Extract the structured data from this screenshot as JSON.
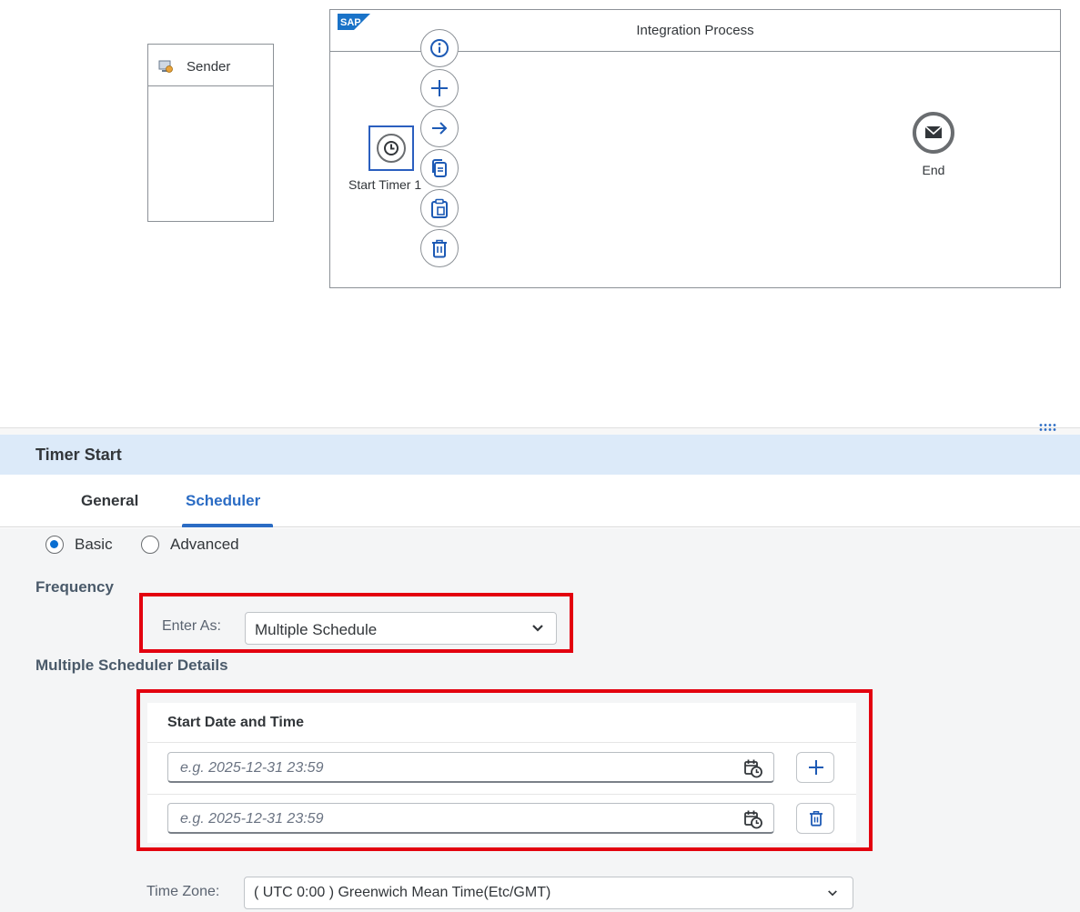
{
  "canvas": {
    "sender_label": "Sender",
    "process_title": "Integration Process",
    "sap_logo_text": "SAP",
    "timer_label": "Start Timer 1",
    "end_label": "End",
    "context_actions": [
      "info-icon",
      "add-icon",
      "arrow-right-icon",
      "copy-icon",
      "paste-icon",
      "delete-icon"
    ]
  },
  "panel": {
    "title": "Timer Start",
    "tabs": [
      {
        "label": "General",
        "active": false
      },
      {
        "label": "Scheduler",
        "active": true
      }
    ],
    "mode": {
      "options": [
        "Basic",
        "Advanced"
      ],
      "selected": "Basic"
    },
    "frequency": {
      "section_label": "Frequency",
      "enter_as_label": "Enter As:",
      "enter_as_value": "Multiple Schedule"
    },
    "multiple": {
      "section_label": "Multiple Scheduler Details",
      "column_header": "Start Date and Time",
      "rows": [
        {
          "placeholder": "e.g. 2025-12-31 23:59",
          "action": "add-icon"
        },
        {
          "placeholder": "e.g. 2025-12-31 23:59",
          "action": "delete-icon"
        }
      ]
    },
    "timezone": {
      "label": "Time Zone:",
      "value": "( UTC 0:00 ) Greenwich Mean Time(Etc/GMT)"
    }
  },
  "colors": {
    "accent": "#2b6cc4",
    "highlight_frame": "#e3000f",
    "panel_header_bg": "#dceaf9",
    "form_bg": "#f4f5f6"
  }
}
